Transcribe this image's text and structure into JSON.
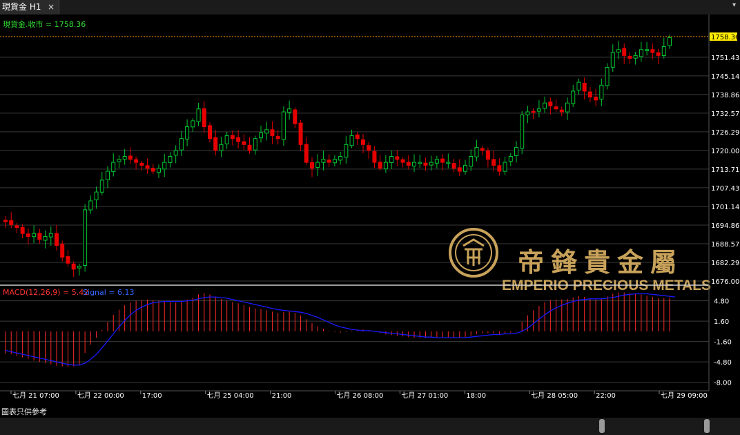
{
  "tab": {
    "title": "現貨金 H1",
    "close": "×",
    "menu": "▾"
  },
  "chart_data": {
    "type": "candlestick",
    "title": "現貨金.收市 = 1758.36",
    "last_price": "1758.36",
    "y_ticks": [
      "1751.43",
      "1745.14",
      "1738.86",
      "1732.57",
      "1726.29",
      "1720.00",
      "1713.71",
      "1707.43",
      "1701.14",
      "1694.86",
      "1688.57",
      "1682.29",
      "1676.00"
    ],
    "ylim": [
      1676.0,
      1760.0
    ],
    "x_labels": [
      "七月 21 07:00",
      "七月 22 00:00",
      "17:00",
      "七月 25 04:00",
      "21:00",
      "七月 26 08:00",
      "七月 27 01:00",
      "18:00",
      "七月 28 05:00",
      "22:00",
      "七月 29 09:00"
    ],
    "close_series": [
      1696,
      1695,
      1694,
      1692,
      1691,
      1692,
      1690,
      1691,
      1692,
      1688,
      1684,
      1682,
      1680,
      1681,
      1700,
      1703,
      1706,
      1710,
      1713,
      1716,
      1717,
      1718,
      1717,
      1716,
      1715,
      1714,
      1713,
      1714,
      1716,
      1718,
      1720,
      1724,
      1728,
      1730,
      1734,
      1728,
      1724,
      1720,
      1722,
      1725,
      1724,
      1723,
      1722,
      1720,
      1724,
      1726,
      1727,
      1725,
      1724,
      1733,
      1734,
      1729,
      1722,
      1716,
      1714,
      1716,
      1717,
      1716,
      1717,
      1718,
      1722,
      1725,
      1724,
      1722,
      1720,
      1716,
      1714,
      1716,
      1718,
      1717,
      1716,
      1715,
      1716,
      1716,
      1715,
      1716,
      1717,
      1716,
      1716,
      1714,
      1713,
      1715,
      1718,
      1721,
      1720,
      1717,
      1715,
      1713,
      1716,
      1718,
      1721,
      1732,
      1733,
      1733,
      1734,
      1736,
      1735,
      1734,
      1733,
      1736,
      1740,
      1743,
      1740,
      1738,
      1737,
      1742,
      1748,
      1753,
      1754,
      1752,
      1751,
      1752,
      1754,
      1754,
      1753,
      1752,
      1755,
      1758
    ],
    "macd": {
      "label": "MACD(12,26,9) = 5.42",
      "signal_label": "Signal = 6.13",
      "y_ticks": [
        "4.80",
        "1.60",
        "-1.60",
        "-4.80",
        "-8.00"
      ],
      "ylim": [
        -8.8,
        6.6
      ],
      "hist": [
        -3.5,
        -3.6,
        -3.9,
        -4.1,
        -4.3,
        -4.6,
        -4.8,
        -5.0,
        -5.2,
        -5.4,
        -5.5,
        -5.6,
        -5.5,
        -5.3,
        -3.4,
        -2.1,
        -1.0,
        0.2,
        1.5,
        2.6,
        3.4,
        4.1,
        4.5,
        4.8,
        4.9,
        5.0,
        4.9,
        4.8,
        4.7,
        4.6,
        4.5,
        4.7,
        5.0,
        5.3,
        5.8,
        6.0,
        5.8,
        5.4,
        5.1,
        4.8,
        4.6,
        4.4,
        4.1,
        3.8,
        3.6,
        3.5,
        3.3,
        3.1,
        2.9,
        3.0,
        3.1,
        2.9,
        2.5,
        1.9,
        1.3,
        0.8,
        0.4,
        0.1,
        -0.1,
        -0.2,
        -0.1,
        0.1,
        0.2,
        0.3,
        0.2,
        0.0,
        -0.3,
        -0.5,
        -0.6,
        -0.7,
        -0.8,
        -0.9,
        -1.0,
        -1.0,
        -1.0,
        -0.9,
        -0.9,
        -0.9,
        -0.9,
        -1.0,
        -1.0,
        -0.9,
        -0.7,
        -0.4,
        -0.3,
        -0.3,
        -0.3,
        -0.4,
        -0.3,
        -0.2,
        0.1,
        1.5,
        2.5,
        3.3,
        4.0,
        4.6,
        4.9,
        5.0,
        5.0,
        5.1,
        5.3,
        5.5,
        5.4,
        5.2,
        5.0,
        5.1,
        5.5,
        5.9,
        6.1,
        6.1,
        6.0,
        5.9,
        5.8,
        5.6,
        5.4,
        5.2,
        5.2,
        5.3
      ],
      "signal": [
        -3.0,
        -3.2,
        -3.4,
        -3.6,
        -3.8,
        -4.0,
        -4.2,
        -4.4,
        -4.6,
        -4.8,
        -5.0,
        -5.2,
        -5.3,
        -5.3,
        -5.0,
        -4.4,
        -3.6,
        -2.6,
        -1.5,
        -0.4,
        0.7,
        1.7,
        2.6,
        3.3,
        3.8,
        4.2,
        4.5,
        4.6,
        4.7,
        4.7,
        4.7,
        4.7,
        4.8,
        4.9,
        5.1,
        5.3,
        5.4,
        5.4,
        5.3,
        5.2,
        5.0,
        4.8,
        4.6,
        4.4,
        4.2,
        4.0,
        3.8,
        3.6,
        3.4,
        3.3,
        3.2,
        3.1,
        3.0,
        2.8,
        2.5,
        2.2,
        1.8,
        1.4,
        1.0,
        0.7,
        0.5,
        0.3,
        0.2,
        0.1,
        0.1,
        0.0,
        -0.1,
        -0.2,
        -0.3,
        -0.4,
        -0.5,
        -0.6,
        -0.7,
        -0.8,
        -0.9,
        -0.9,
        -1.0,
        -1.0,
        -1.0,
        -1.0,
        -1.0,
        -1.0,
        -0.9,
        -0.8,
        -0.7,
        -0.6,
        -0.5,
        -0.5,
        -0.4,
        -0.4,
        -0.3,
        0.0,
        0.5,
        1.2,
        1.9,
        2.6,
        3.2,
        3.7,
        4.1,
        4.4,
        4.7,
        4.9,
        5.0,
        5.1,
        5.1,
        5.1,
        5.2,
        5.3,
        5.5,
        5.7,
        5.8,
        5.9,
        5.9,
        5.9,
        5.8,
        5.7,
        5.6,
        5.5,
        5.4
      ]
    },
    "watermark": {
      "chinese": "帝鋒貴金屬",
      "english": "EMPERIO PRECIOUS METALS"
    },
    "colors": {
      "up": "#00c832",
      "down": "#e60000",
      "macd_hist": "#ff2a2a",
      "signal": "#1a1aff",
      "grid": "#3a3a3a",
      "axis_text": "#ffffff",
      "title_text": "#33dd33",
      "last_price_bg": "#ffee00",
      "gold": "#c8a25a"
    }
  },
  "footer": {
    "note": "圖表只供參考"
  }
}
